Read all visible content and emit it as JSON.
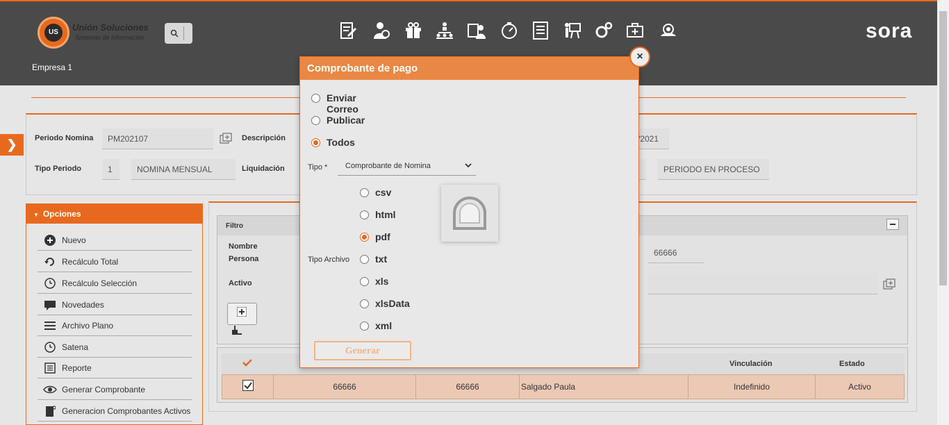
{
  "header": {
    "logo_title": "Unión Soluciones",
    "logo_subtitle": "Sistemas de Información",
    "logo_mark": "UNION US",
    "brand": "sora",
    "company": "Empresa 1",
    "nav_icons": [
      "edit-document-icon",
      "user-money-icon",
      "gift-icon",
      "org-chart-icon",
      "id-card-icon",
      "timer-icon",
      "report-list-icon",
      "training-icon",
      "settings-icon",
      "medical-bag-icon",
      "support-icon"
    ]
  },
  "form": {
    "periodo_nomina_label": "Periodo Nomina",
    "periodo_nomina_value": "PM202107",
    "descripcion_label": "Descripción",
    "fecha_partial": "/2021",
    "tipo_periodo_label": "Tipo Periodo",
    "tipo_periodo_code": "1",
    "tipo_periodo_name": "NOMINA MENSUAL",
    "liquidacion_label": "Liquidación",
    "estado_periodo": "PERIODO EN PROCESO"
  },
  "options": {
    "title": "Opciones",
    "items": [
      {
        "label": "Nuevo",
        "icon": "plus-circle-icon"
      },
      {
        "label": "Recálculo Total",
        "icon": "refresh-icon"
      },
      {
        "label": "Recálculo Selección",
        "icon": "clock-icon"
      },
      {
        "label": "Novedades",
        "icon": "comment-icon"
      },
      {
        "label": "Archivo Plano",
        "icon": "lines-icon"
      },
      {
        "label": "Satena",
        "icon": "clock-icon"
      },
      {
        "label": "Reporte",
        "icon": "report-icon"
      },
      {
        "label": "Generar Comprobante",
        "icon": "eye-icon"
      },
      {
        "label": "Generacion Comprobantes Activos",
        "icon": "document-icon"
      }
    ]
  },
  "filter": {
    "title": "Filtro",
    "nombre_persona_label_1": "Nombre",
    "nombre_persona_label_2": "Persona",
    "activo_label": "Activo",
    "code_value": "66666"
  },
  "grid": {
    "columns": [
      "Vinculación",
      "Estado"
    ],
    "row": {
      "col1": "66666",
      "col2": "66666",
      "nombre": "Salgado Paula",
      "vinculacion": "Indefinido",
      "estado": "Activo"
    }
  },
  "modal": {
    "title": "Comprobante de pago",
    "actions": [
      {
        "label": "Enviar Correo",
        "selected": false
      },
      {
        "label": "Publicar",
        "selected": false
      },
      {
        "label": "Todos",
        "selected": true
      }
    ],
    "tipo_label": "Tipo *",
    "tipo_value": "Comprobante de Nomina",
    "tipo_archivo_label": "Tipo Archivo",
    "file_types": [
      {
        "label": "csv",
        "selected": false
      },
      {
        "label": "html",
        "selected": false
      },
      {
        "label": "pdf",
        "selected": true
      },
      {
        "label": "txt",
        "selected": false
      },
      {
        "label": "xls",
        "selected": false
      },
      {
        "label": "xlsData",
        "selected": false
      },
      {
        "label": "xml",
        "selected": false
      }
    ],
    "generate_label": "Generar",
    "close_label": "×"
  },
  "colors": {
    "accent": "#e8691d",
    "topbar": "#4a4a4a",
    "row_selected": "#ecc9b5"
  }
}
